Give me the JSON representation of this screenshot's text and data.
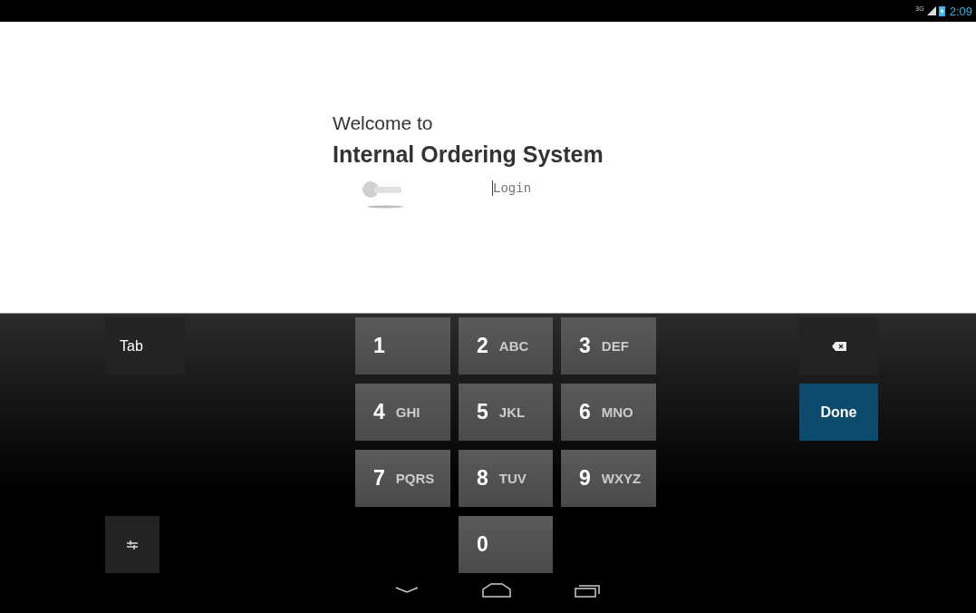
{
  "status_bar": {
    "network": "3G",
    "time": "2:09"
  },
  "welcome": {
    "greeting": "Welcome to",
    "title": "Internal Ordering System"
  },
  "login_field": {
    "placeholder": "Login",
    "focused": true
  },
  "keyboard": {
    "left_keys": [
      {
        "kind": "text",
        "label": "Tab"
      },
      {
        "kind": "settings"
      }
    ],
    "numpad": [
      {
        "digit": "1"
      },
      {
        "digit": "2",
        "letters": "ABC"
      },
      {
        "digit": "3",
        "letters": "DEF"
      },
      {
        "digit": "4",
        "letters": "GHI"
      },
      {
        "digit": "5",
        "letters": "JKL"
      },
      {
        "digit": "6",
        "letters": "MNO"
      },
      {
        "digit": "7",
        "letters": "PQRS"
      },
      {
        "digit": "8",
        "letters": "TUV"
      },
      {
        "digit": "9",
        "letters": "WXYZ"
      },
      {
        "digit": "0"
      }
    ],
    "right_keys": [
      {
        "kind": "backspace"
      },
      {
        "kind": "action",
        "label": "Done"
      }
    ]
  }
}
